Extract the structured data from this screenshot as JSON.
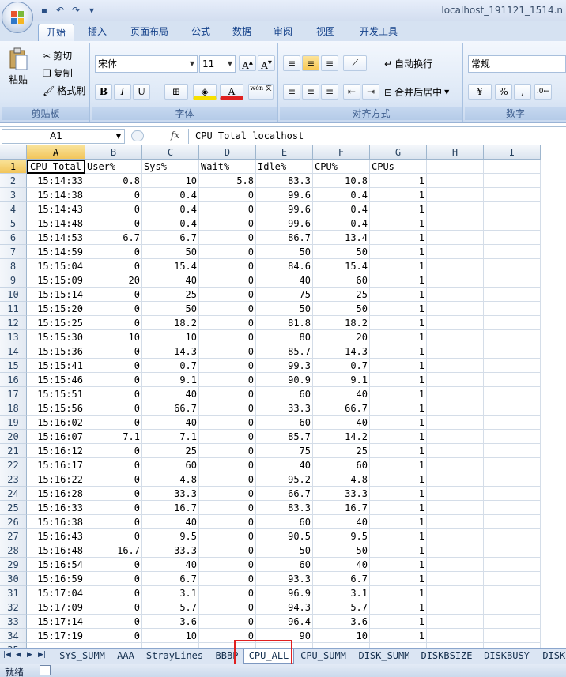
{
  "window_title": "localhost_191121_1514.n",
  "ribbon_tabs": [
    "开始",
    "插入",
    "页面布局",
    "公式",
    "数据",
    "审阅",
    "视图",
    "开发工具"
  ],
  "clipboard": {
    "paste": "粘贴",
    "cut": "剪切",
    "copy": "复制",
    "format_painter": "格式刷",
    "group_label": "剪贴板"
  },
  "font": {
    "name": "宋体",
    "size": "11",
    "bold": "B",
    "italic": "I",
    "underline": "U",
    "phonetic": "wén 文",
    "group_label": "字体"
  },
  "alignment": {
    "wrap": "自动换行",
    "merge": "合并后居中",
    "group_label": "对齐方式"
  },
  "number": {
    "format": "常规",
    "percent": "%",
    "comma": ",",
    "group_label": "数字"
  },
  "name_box": "A1",
  "fx_label": "fx",
  "formula": "CPU Total localhost",
  "columns": [
    "A",
    "B",
    "C",
    "D",
    "E",
    "F",
    "G",
    "H",
    "I"
  ],
  "header_row": [
    "CPU Total",
    "User%",
    "Sys%",
    "Wait%",
    "Idle%",
    "CPU%",
    "CPUs"
  ],
  "rows": [
    [
      "15:14:33",
      "0.8",
      "10",
      "5.8",
      "83.3",
      "10.8",
      "1"
    ],
    [
      "15:14:38",
      "0",
      "0.4",
      "0",
      "99.6",
      "0.4",
      "1"
    ],
    [
      "15:14:43",
      "0",
      "0.4",
      "0",
      "99.6",
      "0.4",
      "1"
    ],
    [
      "15:14:48",
      "0",
      "0.4",
      "0",
      "99.6",
      "0.4",
      "1"
    ],
    [
      "15:14:53",
      "6.7",
      "6.7",
      "0",
      "86.7",
      "13.4",
      "1"
    ],
    [
      "15:14:59",
      "0",
      "50",
      "0",
      "50",
      "50",
      "1"
    ],
    [
      "15:15:04",
      "0",
      "15.4",
      "0",
      "84.6",
      "15.4",
      "1"
    ],
    [
      "15:15:09",
      "20",
      "40",
      "0",
      "40",
      "60",
      "1"
    ],
    [
      "15:15:14",
      "0",
      "25",
      "0",
      "75",
      "25",
      "1"
    ],
    [
      "15:15:20",
      "0",
      "50",
      "0",
      "50",
      "50",
      "1"
    ],
    [
      "15:15:25",
      "0",
      "18.2",
      "0",
      "81.8",
      "18.2",
      "1"
    ],
    [
      "15:15:30",
      "10",
      "10",
      "0",
      "80",
      "20",
      "1"
    ],
    [
      "15:15:36",
      "0",
      "14.3",
      "0",
      "85.7",
      "14.3",
      "1"
    ],
    [
      "15:15:41",
      "0",
      "0.7",
      "0",
      "99.3",
      "0.7",
      "1"
    ],
    [
      "15:15:46",
      "0",
      "9.1",
      "0",
      "90.9",
      "9.1",
      "1"
    ],
    [
      "15:15:51",
      "0",
      "40",
      "0",
      "60",
      "40",
      "1"
    ],
    [
      "15:15:56",
      "0",
      "66.7",
      "0",
      "33.3",
      "66.7",
      "1"
    ],
    [
      "15:16:02",
      "0",
      "40",
      "0",
      "60",
      "40",
      "1"
    ],
    [
      "15:16:07",
      "7.1",
      "7.1",
      "0",
      "85.7",
      "14.2",
      "1"
    ],
    [
      "15:16:12",
      "0",
      "25",
      "0",
      "75",
      "25",
      "1"
    ],
    [
      "15:16:17",
      "0",
      "60",
      "0",
      "40",
      "60",
      "1"
    ],
    [
      "15:16:22",
      "0",
      "4.8",
      "0",
      "95.2",
      "4.8",
      "1"
    ],
    [
      "15:16:28",
      "0",
      "33.3",
      "0",
      "66.7",
      "33.3",
      "1"
    ],
    [
      "15:16:33",
      "0",
      "16.7",
      "0",
      "83.3",
      "16.7",
      "1"
    ],
    [
      "15:16:38",
      "0",
      "40",
      "0",
      "60",
      "40",
      "1"
    ],
    [
      "15:16:43",
      "0",
      "9.5",
      "0",
      "90.5",
      "9.5",
      "1"
    ],
    [
      "15:16:48",
      "16.7",
      "33.3",
      "0",
      "50",
      "50",
      "1"
    ],
    [
      "15:16:54",
      "0",
      "40",
      "0",
      "60",
      "40",
      "1"
    ],
    [
      "15:16:59",
      "0",
      "6.7",
      "0",
      "93.3",
      "6.7",
      "1"
    ],
    [
      "15:17:04",
      "0",
      "3.1",
      "0",
      "96.9",
      "3.1",
      "1"
    ],
    [
      "15:17:09",
      "0",
      "5.7",
      "0",
      "94.3",
      "5.7",
      "1"
    ],
    [
      "15:17:14",
      "0",
      "3.6",
      "0",
      "96.4",
      "3.6",
      "1"
    ],
    [
      "15:17:19",
      "0",
      "10",
      "0",
      "90",
      "10",
      "1"
    ]
  ],
  "sheet_tabs": [
    "SYS_SUMM",
    "AAA",
    "StrayLines",
    "BBBP",
    "CPU_ALL",
    "CPU_SUMM",
    "DISK_SUMM",
    "DISKBSIZE",
    "DISKBUSY",
    "DISKRE"
  ],
  "active_sheet": "CPU_ALL",
  "status_text": "就绪"
}
